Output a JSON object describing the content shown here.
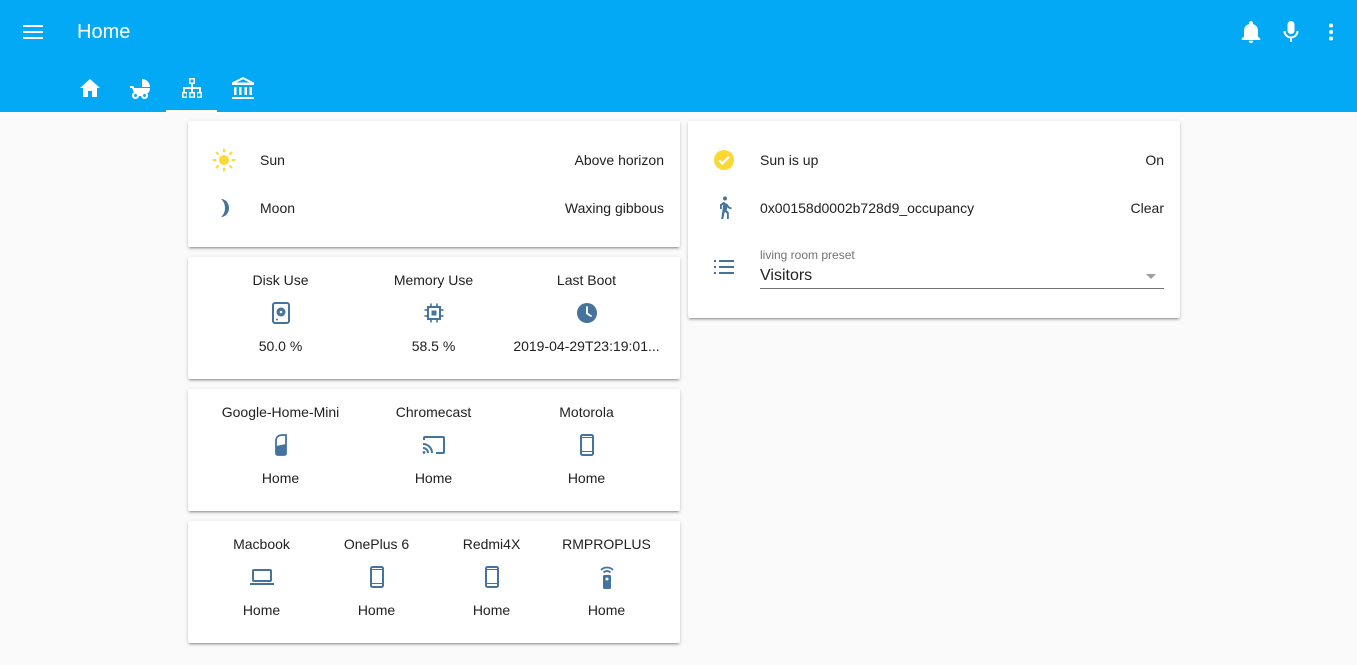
{
  "header": {
    "title": "Home",
    "tabs": [
      {
        "icon": "home-icon"
      },
      {
        "icon": "stroller-icon"
      },
      {
        "icon": "network-icon"
      },
      {
        "icon": "bank-icon"
      }
    ],
    "actions": [
      "bell-icon",
      "microphone-icon",
      "more-vert-icon"
    ],
    "bg_color": "#03a9f4"
  },
  "entities_card": {
    "rows": [
      {
        "icon": "sun-icon",
        "name": "Sun",
        "state": "Above horizon"
      },
      {
        "icon": "moon-icon",
        "name": "Moon",
        "state": "Waxing gibbous"
      }
    ]
  },
  "system_card": {
    "items": [
      {
        "name": "Disk Use",
        "icon": "harddisk-icon",
        "state": "50.0 %"
      },
      {
        "name": "Memory Use",
        "icon": "chip-icon",
        "state": "58.5 %"
      },
      {
        "name": "Last Boot",
        "icon": "clock-icon",
        "state": "2019-04-29T23:19:01..."
      }
    ]
  },
  "devices_card": {
    "items": [
      {
        "name": "Google-Home-Mini",
        "icon": "google-home-icon",
        "state": "Home"
      },
      {
        "name": "Chromecast",
        "icon": "cast-icon",
        "state": "Home"
      },
      {
        "name": "Motorola",
        "icon": "phone-icon",
        "state": "Home"
      }
    ]
  },
  "devices2_card": {
    "items": [
      {
        "name": "Macbook",
        "icon": "laptop-icon",
        "state": "Home"
      },
      {
        "name": "OnePlus 6",
        "icon": "phone-icon",
        "state": "Home"
      },
      {
        "name": "Redmi4X",
        "icon": "phone-icon",
        "state": "Home"
      },
      {
        "name": "RMPROPLUS",
        "icon": "remote-icon",
        "state": "Home"
      }
    ]
  },
  "right_card": {
    "rows": [
      {
        "icon": "check-circle-icon",
        "name": "Sun is up",
        "state": "On"
      },
      {
        "icon": "walk-icon",
        "name": "0x00158d0002b728d9_occupancy",
        "state": "Clear"
      }
    ],
    "select": {
      "icon": "list-icon",
      "label": "living room preset",
      "value": "Visitors"
    }
  },
  "colors": {
    "icon_blue": "#44739e",
    "sun_yellow": "#fdd835",
    "accent": "#03a9f4"
  }
}
